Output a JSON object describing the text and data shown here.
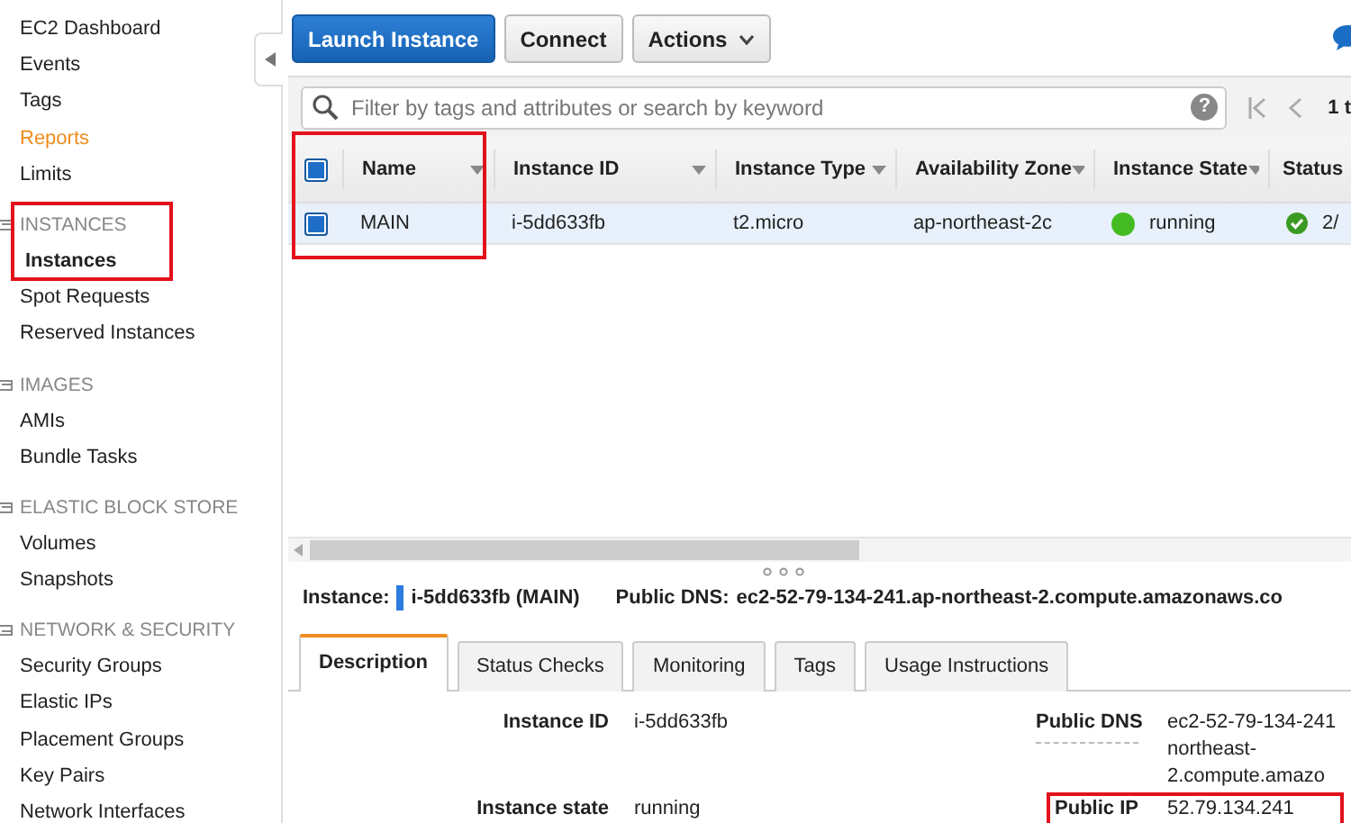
{
  "sidebar": {
    "items": [
      {
        "label": "EC2 Dashboard",
        "selected": false,
        "hovered": false
      },
      {
        "label": "Events",
        "selected": false,
        "hovered": false
      },
      {
        "label": "Tags",
        "selected": false,
        "hovered": false
      },
      {
        "label": "Reports",
        "selected": false,
        "hovered": true
      },
      {
        "label": "Limits",
        "selected": false,
        "hovered": false
      }
    ],
    "sections": [
      {
        "title": "INSTANCES",
        "expanded": true,
        "items": [
          {
            "label": "Instances",
            "selected": true,
            "hovered": false
          },
          {
            "label": "Spot Requests",
            "selected": false,
            "hovered": false
          },
          {
            "label": "Reserved Instances",
            "selected": false,
            "hovered": false
          }
        ]
      },
      {
        "title": "IMAGES",
        "expanded": true,
        "items": [
          {
            "label": "AMIs",
            "selected": false,
            "hovered": false
          },
          {
            "label": "Bundle Tasks",
            "selected": false,
            "hovered": false
          }
        ]
      },
      {
        "title": "ELASTIC BLOCK STORE",
        "expanded": true,
        "items": [
          {
            "label": "Volumes",
            "selected": false,
            "hovered": false
          },
          {
            "label": "Snapshots",
            "selected": false,
            "hovered": false
          }
        ]
      },
      {
        "title": "NETWORK & SECURITY",
        "expanded": true,
        "items": [
          {
            "label": "Security Groups",
            "selected": false,
            "hovered": false
          },
          {
            "label": "Elastic IPs",
            "selected": false,
            "hovered": false
          },
          {
            "label": "Placement Groups",
            "selected": false,
            "hovered": false
          },
          {
            "label": "Key Pairs",
            "selected": false,
            "hovered": false
          },
          {
            "label": "Network Interfaces",
            "selected": false,
            "hovered": false
          }
        ]
      }
    ]
  },
  "toolbar": {
    "buttons": [
      {
        "label": "Launch Instance",
        "kind": "primary"
      },
      {
        "label": "Connect",
        "kind": "plain"
      },
      {
        "label": "Actions",
        "kind": "dropdown"
      }
    ]
  },
  "filter": {
    "placeholder": "Filter by tags and attributes or search by keyword",
    "help": "?"
  },
  "pager": {
    "text": "1 t"
  },
  "table": {
    "all_checked": true,
    "columns": [
      "Name",
      "Instance ID",
      "Instance Type",
      "Availability Zone",
      "Instance State",
      "Status"
    ],
    "rows": [
      {
        "selected": true,
        "checked": true,
        "cells": [
          "MAIN",
          "i-5dd633fb",
          "t2.micro",
          "ap-northeast-2c",
          "running",
          "2/"
        ],
        "color": "#44bb22"
      }
    ]
  },
  "instance_bar": {
    "label": "Instance:",
    "id": "i-5dd633fb (MAIN)",
    "dns_label": "Public DNS:",
    "dns": "ec2-52-79-134-241.ap-northeast-2.compute.amazonaws.co"
  },
  "tabs": [
    {
      "label": "Description",
      "selected": true
    },
    {
      "label": "Status Checks",
      "selected": false
    },
    {
      "label": "Monitoring",
      "selected": false
    },
    {
      "label": "Tags",
      "selected": false
    },
    {
      "label": "Usage Instructions",
      "selected": false
    }
  ],
  "details": {
    "left": [
      {
        "label": "Instance ID",
        "value": [
          "i-5dd633fb"
        ]
      },
      {
        "label": "Instance state",
        "value": [
          "running"
        ]
      }
    ],
    "right": [
      {
        "label": "Public DNS",
        "value": [
          "ec2-52-79-134-241",
          "northeast-",
          "2.compute.amazo"
        ]
      },
      {
        "label": "Public IP",
        "value": [
          "52.79.134.241"
        ]
      }
    ]
  }
}
